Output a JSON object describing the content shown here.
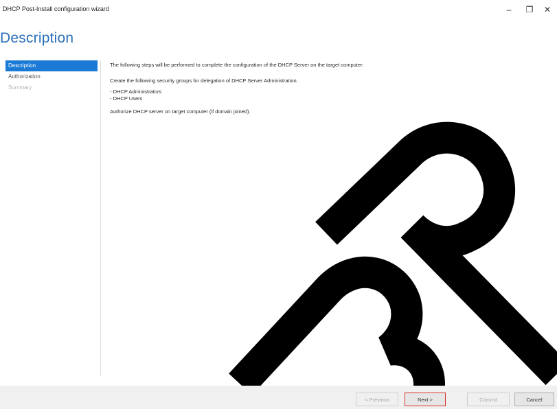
{
  "window": {
    "title": "DHCP Post-Install configuration wizard",
    "minimize_glyph": "–",
    "maximize_glyph": "❐",
    "close_glyph": "✕"
  },
  "page": {
    "heading": "Description"
  },
  "nav": {
    "items": [
      {
        "label": "Description",
        "state": "active"
      },
      {
        "label": "Authorization",
        "state": "normal"
      },
      {
        "label": "Summary",
        "state": "disabled"
      }
    ]
  },
  "content": {
    "intro": "The following steps will be performed to complete the configuration of the DHCP Server on the target computer:",
    "groups_intro": "Create the following security groups for delegation of DHCP Server Administration.",
    "groups": [
      "- DHCP Administrators",
      "- DHCP Users"
    ],
    "authorize": "Authorize DHCP server on target computer (if domain joined)."
  },
  "buttons": {
    "previous": "< Previous",
    "next": "Next >",
    "commit": "Commit",
    "cancel": "Cancel"
  },
  "colors": {
    "accent": "#1a7ad6",
    "heading": "#2a6fba",
    "next_highlight": "#d9342b"
  },
  "watermark": {
    "text": "BP"
  }
}
